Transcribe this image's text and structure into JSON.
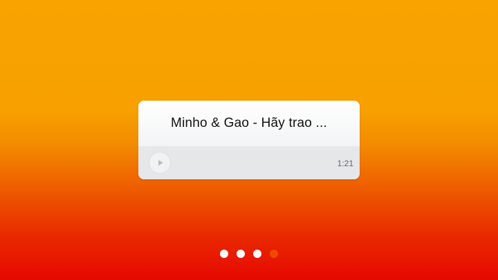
{
  "track_card": {
    "title": "Minho & Gao - Hãy trao ...",
    "duration": "1:21",
    "play_icon": "play-icon"
  },
  "pagination": {
    "total": 4,
    "active_index": 3,
    "active_color": "#ee4a00",
    "inactive_color": "#ffffff"
  },
  "colors": {
    "background_top": "#f7a300",
    "background_bottom": "#e60800"
  }
}
